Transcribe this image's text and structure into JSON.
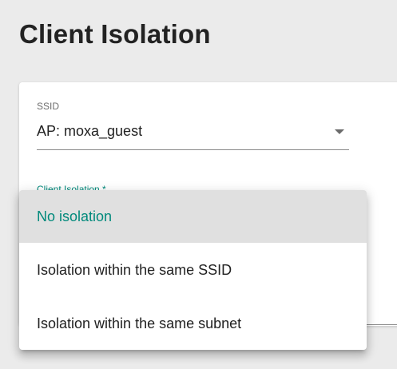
{
  "page": {
    "title": "Client Isolation"
  },
  "ssid": {
    "label": "SSID",
    "value": "AP: moxa_guest"
  },
  "client_isolation": {
    "label": "Client Isolation *",
    "options": [
      {
        "label": "No isolation",
        "selected": true
      },
      {
        "label": "Isolation within the same SSID",
        "selected": false
      },
      {
        "label": "Isolation within the same subnet",
        "selected": false
      }
    ]
  },
  "colors": {
    "accent": "#00897b",
    "selected_bg": "#e0e0e0",
    "page_bg": "#ebebeb"
  }
}
